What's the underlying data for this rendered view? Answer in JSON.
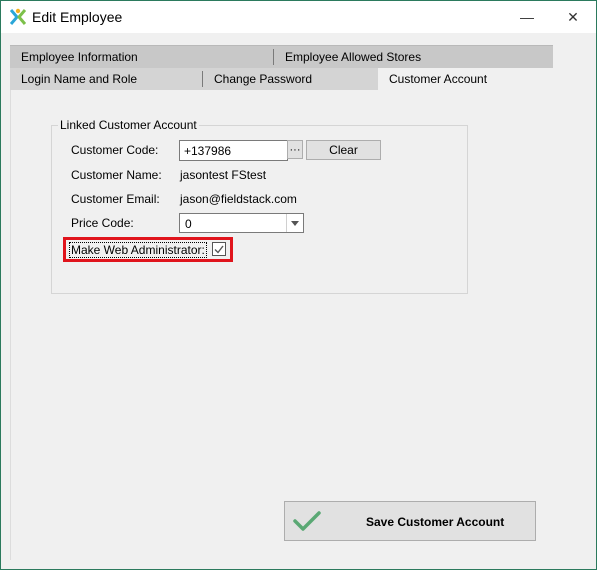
{
  "window": {
    "title": "Edit Employee",
    "minimize_glyph": "—",
    "close_glyph": "✕",
    "app_icon": "fieldstack-logo-icon"
  },
  "tabs": {
    "row1": [
      "Employee Information",
      "Employee Allowed Stores"
    ],
    "row2": [
      "Login Name and Role",
      "Change Password",
      "Customer Account"
    ],
    "active": "Customer Account"
  },
  "linked_account": {
    "legend": "Linked Customer Account",
    "customer_code_label": "Customer Code:",
    "customer_code_value": "+137986",
    "ellipsis_label": "···",
    "clear_label": "Clear",
    "customer_name_label": "Customer Name:",
    "customer_name_value": "jasontest FStest",
    "customer_email_label": "Customer Email:",
    "customer_email_value": "jason@fieldstack.com",
    "price_code_label": "Price Code:",
    "price_code_value": "0",
    "web_admin_label": "Make Web Administrator:",
    "web_admin_checked": true
  },
  "actions": {
    "save_label": "Save Customer Account"
  },
  "colors": {
    "highlight": "#e0141c",
    "check_green": "#5aa874",
    "window_border": "#2b7a5d"
  }
}
